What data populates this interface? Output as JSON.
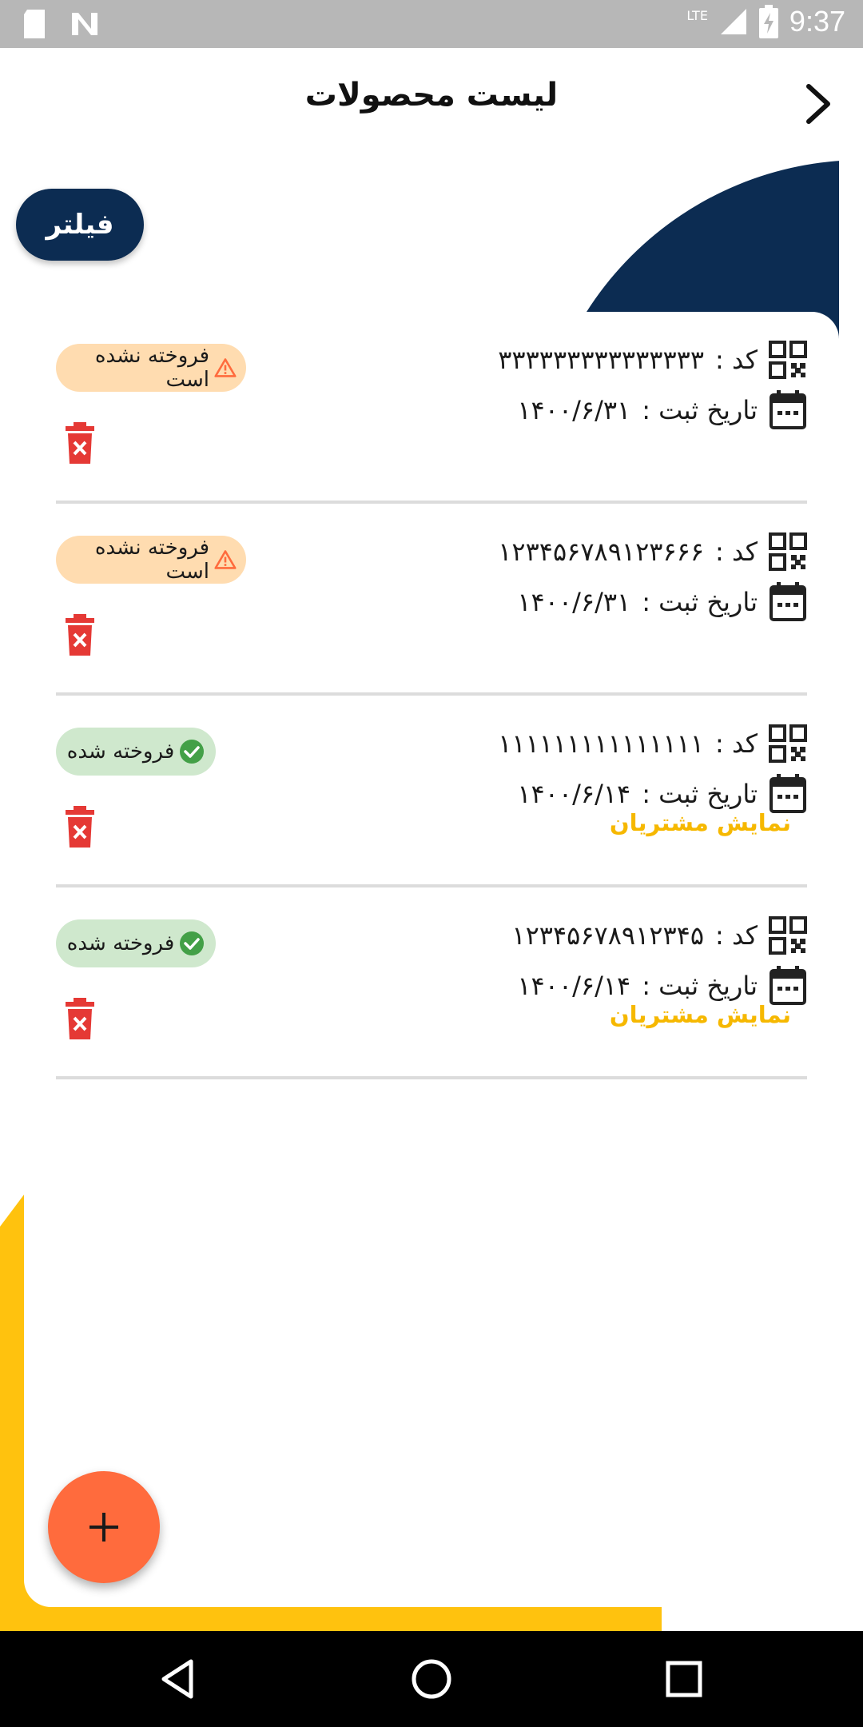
{
  "status_bar": {
    "time": "9:37",
    "network": "LTE"
  },
  "header": {
    "title": "لیست محصولات"
  },
  "filter": {
    "label": "فیلتر"
  },
  "products": [
    {
      "code_label": "کد :",
      "code": "۳۳۳۳۳۳۳۳۳۳۳۳۳۳۳",
      "date_label": "تاریخ ثبت :",
      "date": "۱۴۰۰/۶/۳۱",
      "status": "فروخته نشده است",
      "sold": false,
      "link": ""
    },
    {
      "code_label": "کد :",
      "code": "۱۲۳۴۵۶۷۸۹۱۲۳۶۶۶",
      "date_label": "تاریخ ثبت :",
      "date": "۱۴۰۰/۶/۳۱",
      "status": "فروخته نشده است",
      "sold": false,
      "link": ""
    },
    {
      "code_label": "کد :",
      "code": "۱۱۱۱۱۱۱۱۱۱۱۱۱۱۱",
      "date_label": "تاریخ ثبت :",
      "date": "۱۴۰۰/۶/۱۴",
      "status": "فروخته شده",
      "sold": true,
      "link": "نمایش مشتریان"
    },
    {
      "code_label": "کد :",
      "code": "۱۲۳۴۵۶۷۸۹۱۲۳۴۵",
      "date_label": "تاریخ ثبت :",
      "date": "۱۴۰۰/۶/۱۴",
      "status": "فروخته شده",
      "sold": true,
      "link": "نمایش مشتریان"
    }
  ],
  "colors": {
    "navy": "#0c2c52",
    "yellow": "#ffc20e",
    "fab": "#ff6b3d",
    "warn_bg": "#ffdcb0",
    "ok_bg": "#cfe8cd",
    "link": "#f6b800",
    "trash": "#e53935"
  },
  "icons": [
    "back-chevron-icon",
    "qr-code-icon",
    "calendar-icon",
    "warning-icon",
    "check-circle-icon",
    "trash-icon",
    "plus-icon"
  ]
}
